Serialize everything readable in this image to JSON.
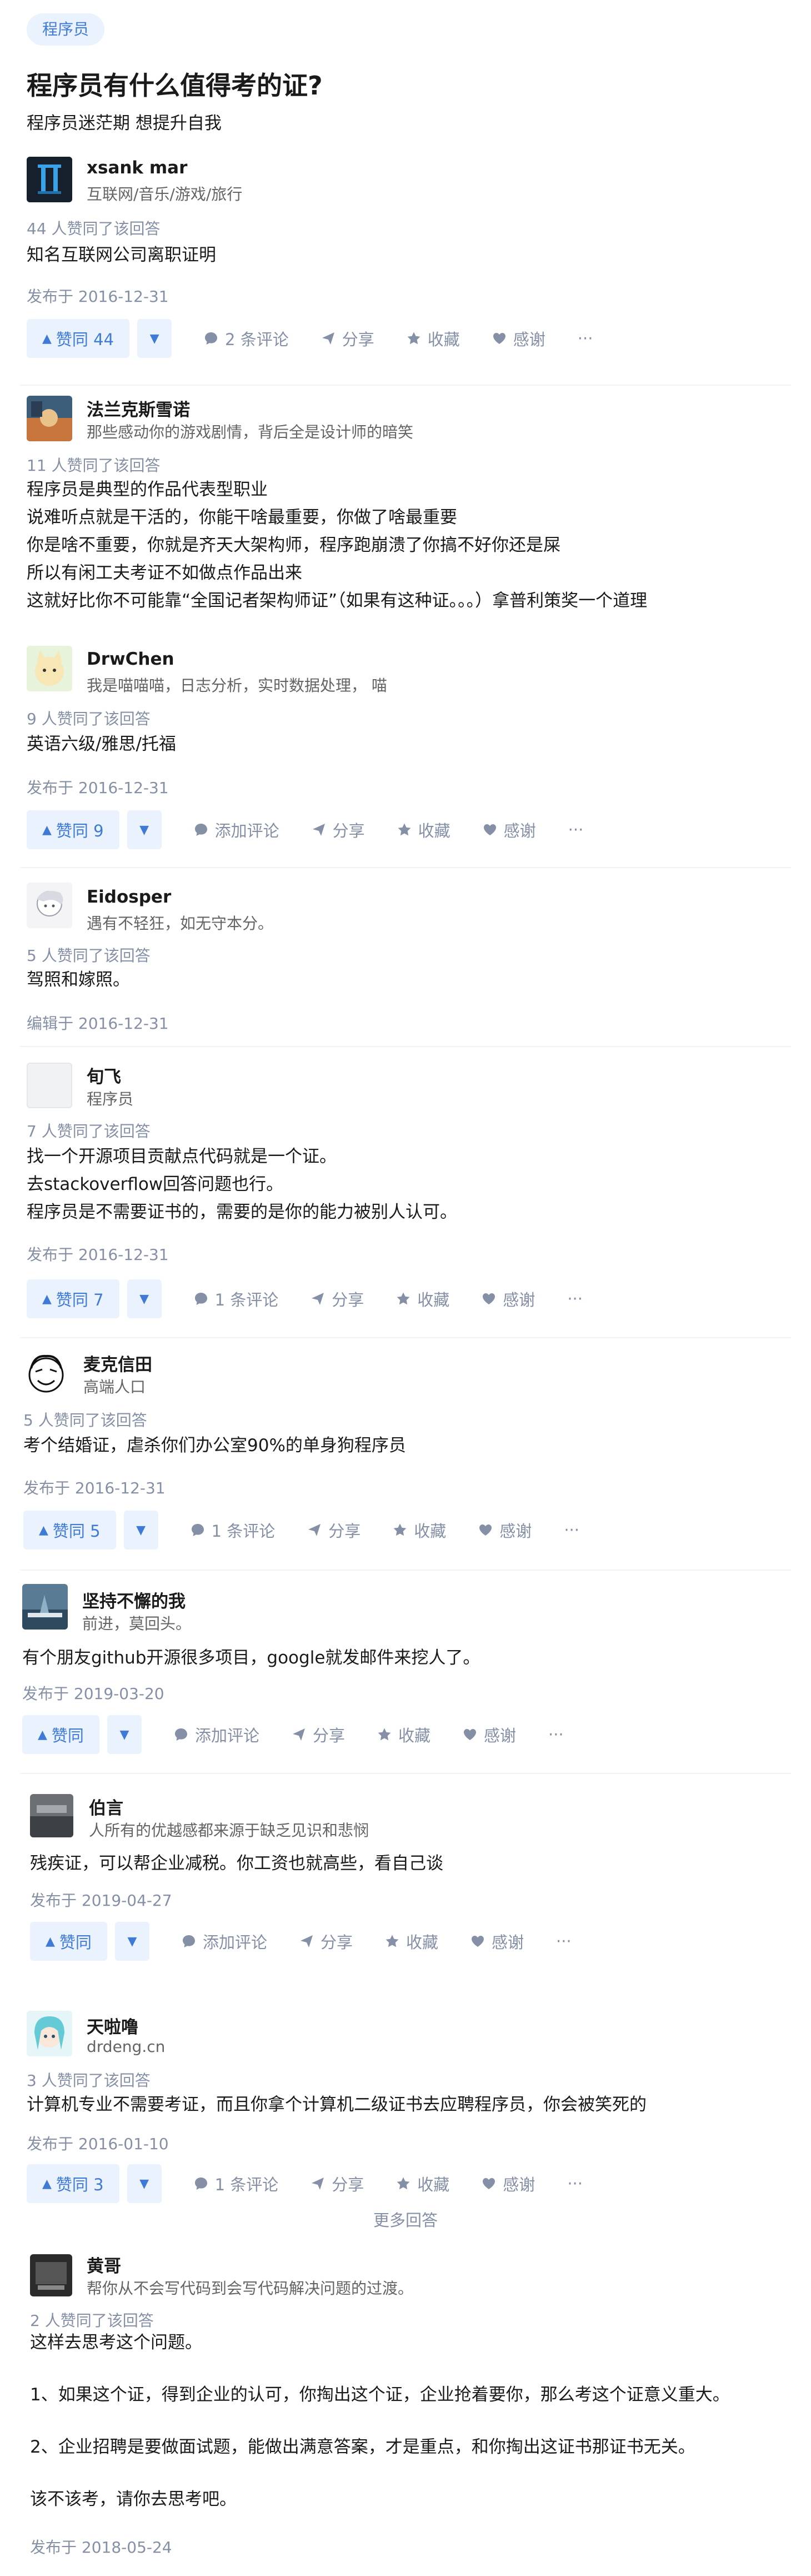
{
  "topic": {
    "tag": "程序员"
  },
  "question": {
    "title": "程序员有什么值得考的证?",
    "subtitle": "程序员迷茫期 想提升自我"
  },
  "more_answers": "更多回答",
  "answers": [
    {
      "name": "xsank mar",
      "bio": "互联网/音乐/游戏/旅行",
      "votes_text": "44 人赞同了该回答",
      "content": [
        "知名互联网公司离职证明"
      ],
      "date": "发布于 2016-12-31",
      "vote_label": "赞同 44",
      "comment_label": "2 条评论",
      "share": "分享",
      "favorite": "收藏",
      "thanks": "感谢"
    },
    {
      "name": "法兰克斯雪诺",
      "bio": "那些感动你的游戏剧情，背后全是设计师的暗笑",
      "votes_text": "11 人赞同了该回答",
      "content": [
        "程序员是典型的作品代表型职业",
        "说难听点就是干活的，你能干啥最重要，你做了啥最重要",
        "你是啥不重要，你就是齐天大架构师，程序跑崩溃了你搞不好你还是屎",
        "所以有闲工夫考证不如做点作品出来",
        "这就好比你不可能靠“全国记者架构师证”（如果有这种证。。。）拿普利策奖一个道理"
      ]
    },
    {
      "name": "DrwChen",
      "bio": "我是喵喵喵，日志分析，实时数据处理， 喵",
      "votes_text": "9 人赞同了该回答",
      "content": [
        "英语六级/雅思/托福"
      ],
      "date": "发布于 2016-12-31",
      "vote_label": "赞同 9",
      "comment_label": "添加评论",
      "share": "分享",
      "favorite": "收藏",
      "thanks": "感谢"
    },
    {
      "name": "Eidosper",
      "bio": "遇有不轻狂，如无守本分。",
      "votes_text": "5 人赞同了该回答",
      "content": [
        "驾照和嫁照。"
      ],
      "date": "编辑于 2016-12-31"
    },
    {
      "name": "旬飞",
      "bio": "程序员",
      "votes_text": "7 人赞同了该回答",
      "content": [
        "找一个开源项目贡献点代码就是一个证。",
        "去stackoverflow回答问题也行。",
        "程序员是不需要证书的，需要的是你的能力被别人认可。"
      ],
      "date": "发布于 2016-12-31",
      "vote_label": "赞同 7",
      "comment_label": "1 条评论",
      "share": "分享",
      "favorite": "收藏",
      "thanks": "感谢"
    },
    {
      "name": "麦克信田",
      "bio": "高端人口",
      "votes_text": "5 人赞同了该回答",
      "content": [
        "考个结婚证，虐杀你们办公室90%的单身狗程序员"
      ],
      "date": "发布于 2016-12-31",
      "vote_label": "赞同 5",
      "comment_label": "1 条评论",
      "share": "分享",
      "favorite": "收藏",
      "thanks": "感谢"
    },
    {
      "name": "坚持不懈的我",
      "bio": "前进，莫回头。",
      "content": [
        "有个朋友github开源很多项目，google就发邮件来挖人了。"
      ],
      "date": "发布于 2019-03-20",
      "vote_label": "赞同",
      "comment_label": "添加评论",
      "share": "分享",
      "favorite": "收藏",
      "thanks": "感谢"
    },
    {
      "name": "伯言",
      "bio": "人所有的优越感都来源于缺乏见识和悲悯",
      "content": [
        "残疾证，可以帮企业减税。你工资也就高些，看自己谈"
      ],
      "date": "发布于 2019-04-27",
      "vote_label": "赞同",
      "comment_label": "添加评论",
      "share": "分享",
      "favorite": "收藏",
      "thanks": "感谢"
    },
    {
      "name": "天啦噜",
      "bio": "drdeng.cn",
      "votes_text": "3 人赞同了该回答",
      "content": [
        "计算机专业不需要考证，而且你拿个计算机二级证书去应聘程序员，你会被笑死的"
      ],
      "date": "发布于 2016-01-10",
      "vote_label": "赞同 3",
      "comment_label": "1 条评论",
      "share": "分享",
      "favorite": "收藏",
      "thanks": "感谢"
    },
    {
      "name": "黄哥",
      "bio": "帮你从不会写代码到会写代码解决问题的过渡。",
      "votes_text": "2 人赞同了该回答",
      "content": [
        "这样去思考这个问题。",
        "",
        "1、如果这个证，得到企业的认可，你掏出这个证，企业抢着要你，那么考这个证意义重大。",
        "",
        "2、企业招聘是要做面试题，能做出满意答案，才是重点，和你掏出这证书那证书无关。",
        "",
        "该不该考，请你去思考吧。"
      ],
      "date": "发布于 2018-05-24"
    }
  ]
}
